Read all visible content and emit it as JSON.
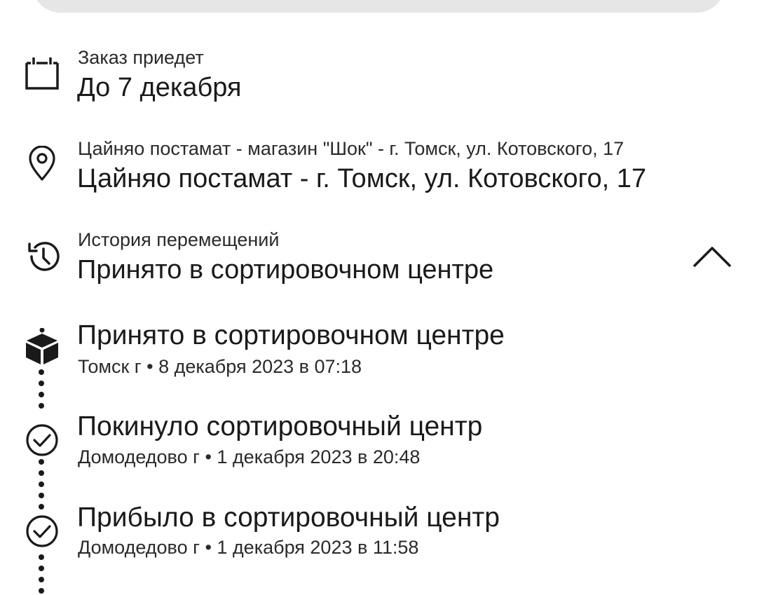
{
  "delivery": {
    "label": "Заказ приедет",
    "value": "До 7 декабря",
    "icon": "calendar-icon"
  },
  "pickup": {
    "label": "Цайняо постамат - магазин \"Шок\" - г. Томск, ул. Котовского, 17",
    "value": "Цайняо постамат - г. Томск, ул. Котовского, 17",
    "icon": "location-pin-icon"
  },
  "history": {
    "label": "История перемещений",
    "value": "Принято в сортировочном центре",
    "icon": "history-icon",
    "toggle_icon": "chevron-up-icon"
  },
  "events": [
    {
      "title": "Принято в сортировочном центре",
      "meta": "Томск г • 8 декабря 2023 в 07:18",
      "icon": "package-box-icon"
    },
    {
      "title": "Покинуло сортировочный центр",
      "meta": "Домодедово г • 1 декабря 2023 в 20:48",
      "icon": "check-circle-icon"
    },
    {
      "title": "Прибыло в сортировочный центр",
      "meta": "Домодедово г • 1 декабря 2023 в 11:58",
      "icon": "check-circle-icon"
    }
  ],
  "colors": {
    "text": "#1a1a1a",
    "card_background": "#e6e6e6"
  }
}
